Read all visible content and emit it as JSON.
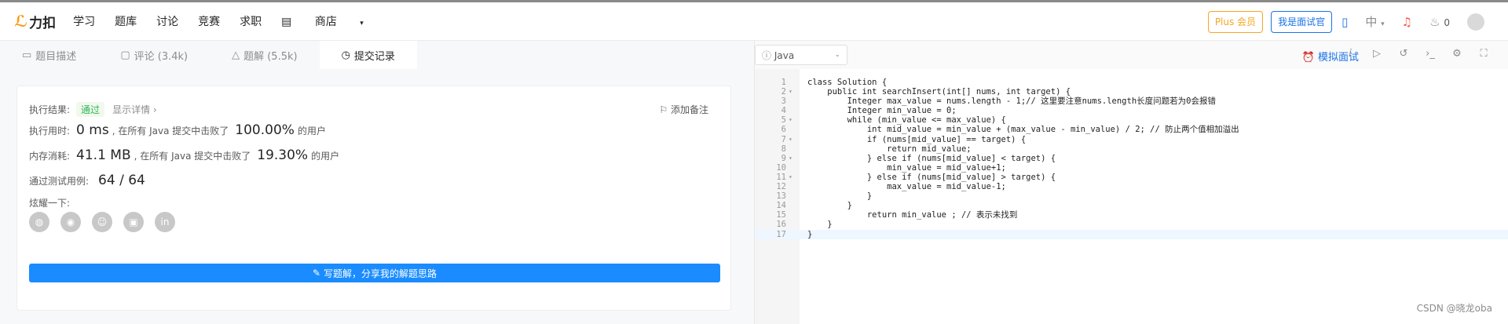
{
  "header": {
    "logo_text": "力扣",
    "nav": [
      "学习",
      "题库",
      "讨论",
      "竞赛",
      "求职"
    ],
    "shop_label": "商店",
    "plus_label": "Plus 会员",
    "interviewer_label": "我是面试官",
    "lang_label": "中",
    "points_count": "0"
  },
  "left_tabs": [
    {
      "label": "题目描述"
    },
    {
      "label": "评论 (3.4k)"
    },
    {
      "label": "题解 (5.5k)"
    },
    {
      "label": "提交记录"
    }
  ],
  "result": {
    "status_label": "执行结果:",
    "status_value": "通过",
    "detail_link": "显示详情 ›",
    "add_note": "添加备注",
    "runtime_label": "执行用时:",
    "runtime_value": "0 ms",
    "runtime_text": ", 在所有 Java 提交中击败了",
    "runtime_pct": "100.00%",
    "runtime_suffix": "的用户",
    "memory_label": "内存消耗:",
    "memory_value": "41.1 MB",
    "memory_text": ", 在所有 Java 提交中击败了",
    "memory_pct": "19.30%",
    "memory_suffix": "的用户",
    "tests_label": "通过测试用例:",
    "tests_value": "64 / 64",
    "share_label": "炫耀一下:",
    "write_button": "写题解，分享我的解题思路"
  },
  "editor_toolbar": {
    "language": "Java",
    "mock_interview": "模拟面试"
  },
  "code_lines": [
    "class Solution {",
    "    public int searchInsert(int[] nums, int target) {",
    "        Integer max_value = nums.length - 1;// 这里要注意nums.length长度问题若为0会报错",
    "        Integer min_value = 0;",
    "        while (min_value <= max_value) {",
    "            int mid_value = min_value + (max_value - min_value) / 2; // 防止两个值相加溢出",
    "            if (nums[mid_value] == target) {",
    "                return mid_value;",
    "            } else if (nums[mid_value] < target) {",
    "                min_value = mid_value+1;",
    "            } else if (nums[mid_value] > target) {",
    "                max_value = mid_value-1;",
    "            }",
    "        }",
    "            return min_value ; // 表示未找到",
    "    }",
    "}"
  ],
  "fold_lines": [
    2,
    5,
    7,
    9,
    11
  ],
  "watermark": "CSDN @晓龙oba"
}
